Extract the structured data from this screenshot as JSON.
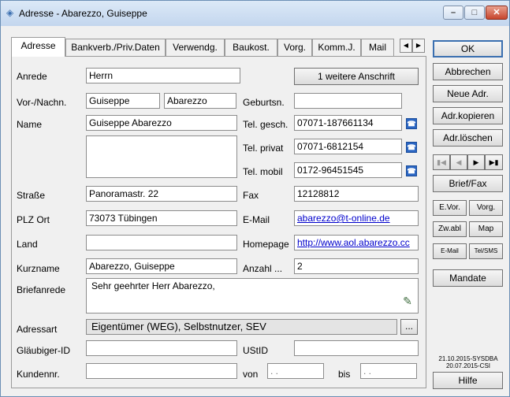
{
  "window": {
    "title": "Adresse - Abarezzo, Guiseppe"
  },
  "tabs": [
    {
      "label": "Adresse"
    },
    {
      "label": "Bankverb./Priv.Daten"
    },
    {
      "label": "Verwendg."
    },
    {
      "label": "Baukost."
    },
    {
      "label": "Vorg."
    },
    {
      "label": "Komm.J."
    },
    {
      "label": "Mail"
    }
  ],
  "form": {
    "anrede": {
      "label": "Anrede",
      "value": "Herrn"
    },
    "extra_address_button": "1 weitere Anschrift",
    "vor_nachname": {
      "label": "Vor-/Nachn.",
      "vorname": "Guiseppe",
      "nachname": "Abarezzo"
    },
    "geburtsname": {
      "label": "Geburtsn.",
      "value": ""
    },
    "name": {
      "label": "Name",
      "value": "Guiseppe Abarezzo",
      "line2": ""
    },
    "tel_gesch": {
      "label": "Tel. gesch.",
      "value": "07071-187661134"
    },
    "tel_privat": {
      "label": "Tel. privat",
      "value": "07071-6812154"
    },
    "tel_mobil": {
      "label": "Tel. mobil",
      "value": "0172-96451545"
    },
    "strasse": {
      "label": "Straße",
      "value": "Panoramastr. 22"
    },
    "fax": {
      "label": "Fax",
      "value": "12128812"
    },
    "plz_ort": {
      "label": "PLZ Ort",
      "value": "73073 Tübingen"
    },
    "email": {
      "label": "E-Mail",
      "value": "abarezzo@t-online.de"
    },
    "land": {
      "label": "Land",
      "value": ""
    },
    "homepage": {
      "label": "Homepage",
      "value": "http://www.aol.abarezzo.cc"
    },
    "kurzname": {
      "label": "Kurzname",
      "value": "Abarezzo, Guiseppe"
    },
    "anzahl": {
      "label": "Anzahl ...",
      "value": "2"
    },
    "briefanrede": {
      "label": "Briefanrede",
      "value": "Sehr geehrter Herr Abarezzo,"
    },
    "adressart": {
      "label": "Adressart",
      "value": "Eigentümer (WEG), Selbstnutzer, SEV",
      "button": "..."
    },
    "glaeubiger_id": {
      "label": "Gläubiger-ID",
      "value": ""
    },
    "ustid": {
      "label": "UStID",
      "value": ""
    },
    "kundennr": {
      "label": "Kundennr.",
      "value": ""
    },
    "von": {
      "label": "von",
      "value": " .  . "
    },
    "bis": {
      "label": "bis",
      "value": " .  . "
    }
  },
  "side": {
    "ok": "OK",
    "abbrechen": "Abbrechen",
    "neue_adr": "Neue Adr.",
    "adr_kopieren": "Adr.kopieren",
    "adr_loeschen": "Adr.löschen",
    "brief_fax": "Brief/Fax",
    "e_vor": "E.Vor.",
    "vorg": "Vorg.",
    "z_w_abl": "Zw.abl",
    "map": "Map",
    "e_mail": "E-Mail",
    "tel_sms": "Tel/SMS",
    "mandate": "Mandate",
    "version_line1": "21.10.2015-SYSDBA",
    "version_line2": "20.07.2015-CSI",
    "hilfe": "Hilfe"
  }
}
